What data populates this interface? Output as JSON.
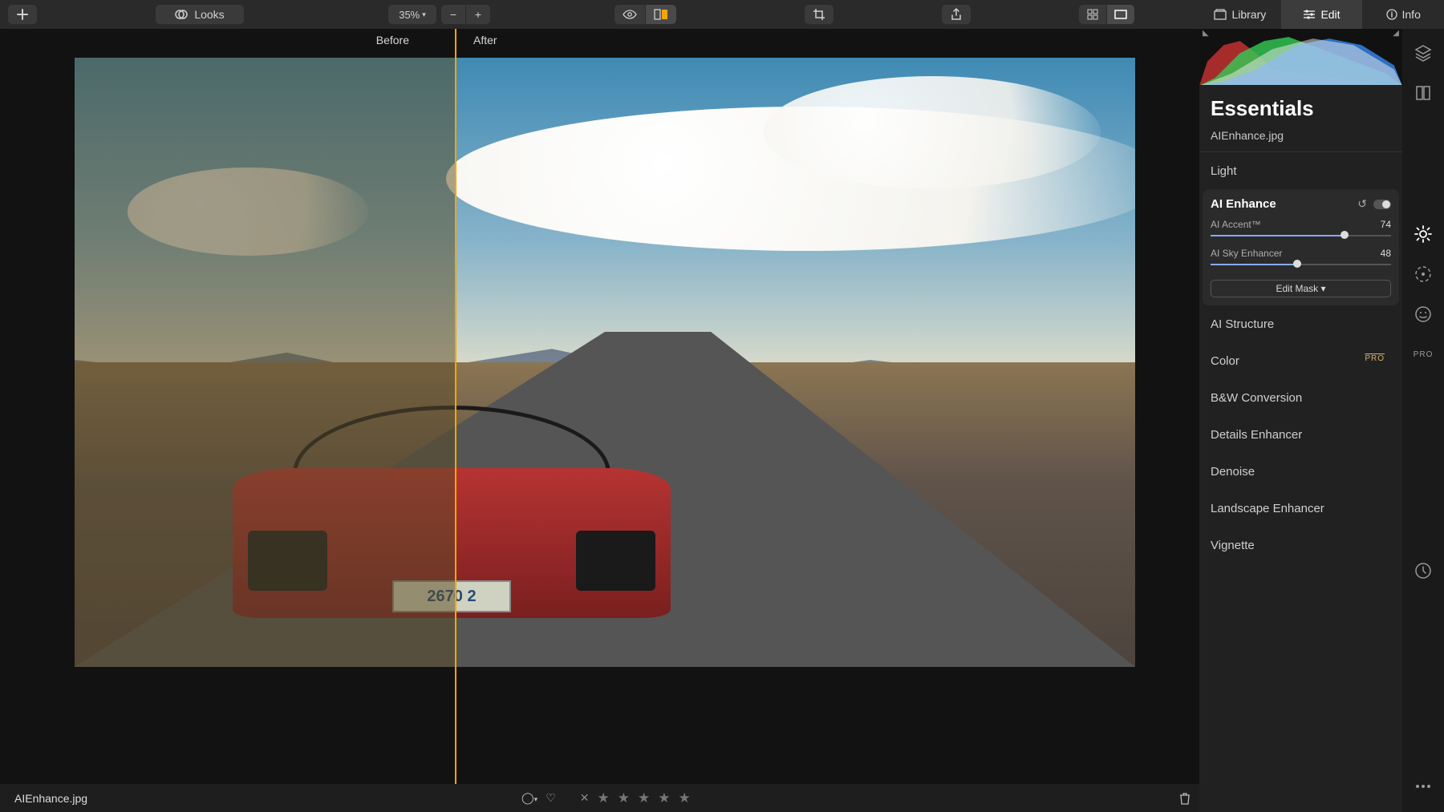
{
  "toolbar": {
    "looks_label": "Looks",
    "zoom_label": "35% ",
    "zoom_value": 35
  },
  "compare": {
    "before_label": "Before",
    "after_label": "After",
    "split_pct": 43
  },
  "photo": {
    "plate": "2670 2"
  },
  "footer": {
    "filename": "AIEnhance.jpg",
    "rating_stars": 5
  },
  "mode_tabs": {
    "library": "Library",
    "edit": "Edit",
    "info": "Info",
    "active": "edit"
  },
  "panel": {
    "title": "Essentials",
    "filename": "AIEnhance.jpg",
    "sections": {
      "light": "Light",
      "ai_enhance": "AI Enhance",
      "ai_structure": "AI Structure",
      "color": "Color",
      "bw": "B&W Conversion",
      "details": "Details Enhancer",
      "denoise": "Denoise",
      "landscape": "Landscape Enhancer",
      "vignette": "Vignette"
    },
    "ai_enhance": {
      "accent_label": "AI Accent™",
      "accent_value": 74,
      "sky_label": "AI Sky Enhancer",
      "sky_value": 48,
      "edit_mask": "Edit Mask ▾"
    },
    "pro_badge": "PRO"
  }
}
